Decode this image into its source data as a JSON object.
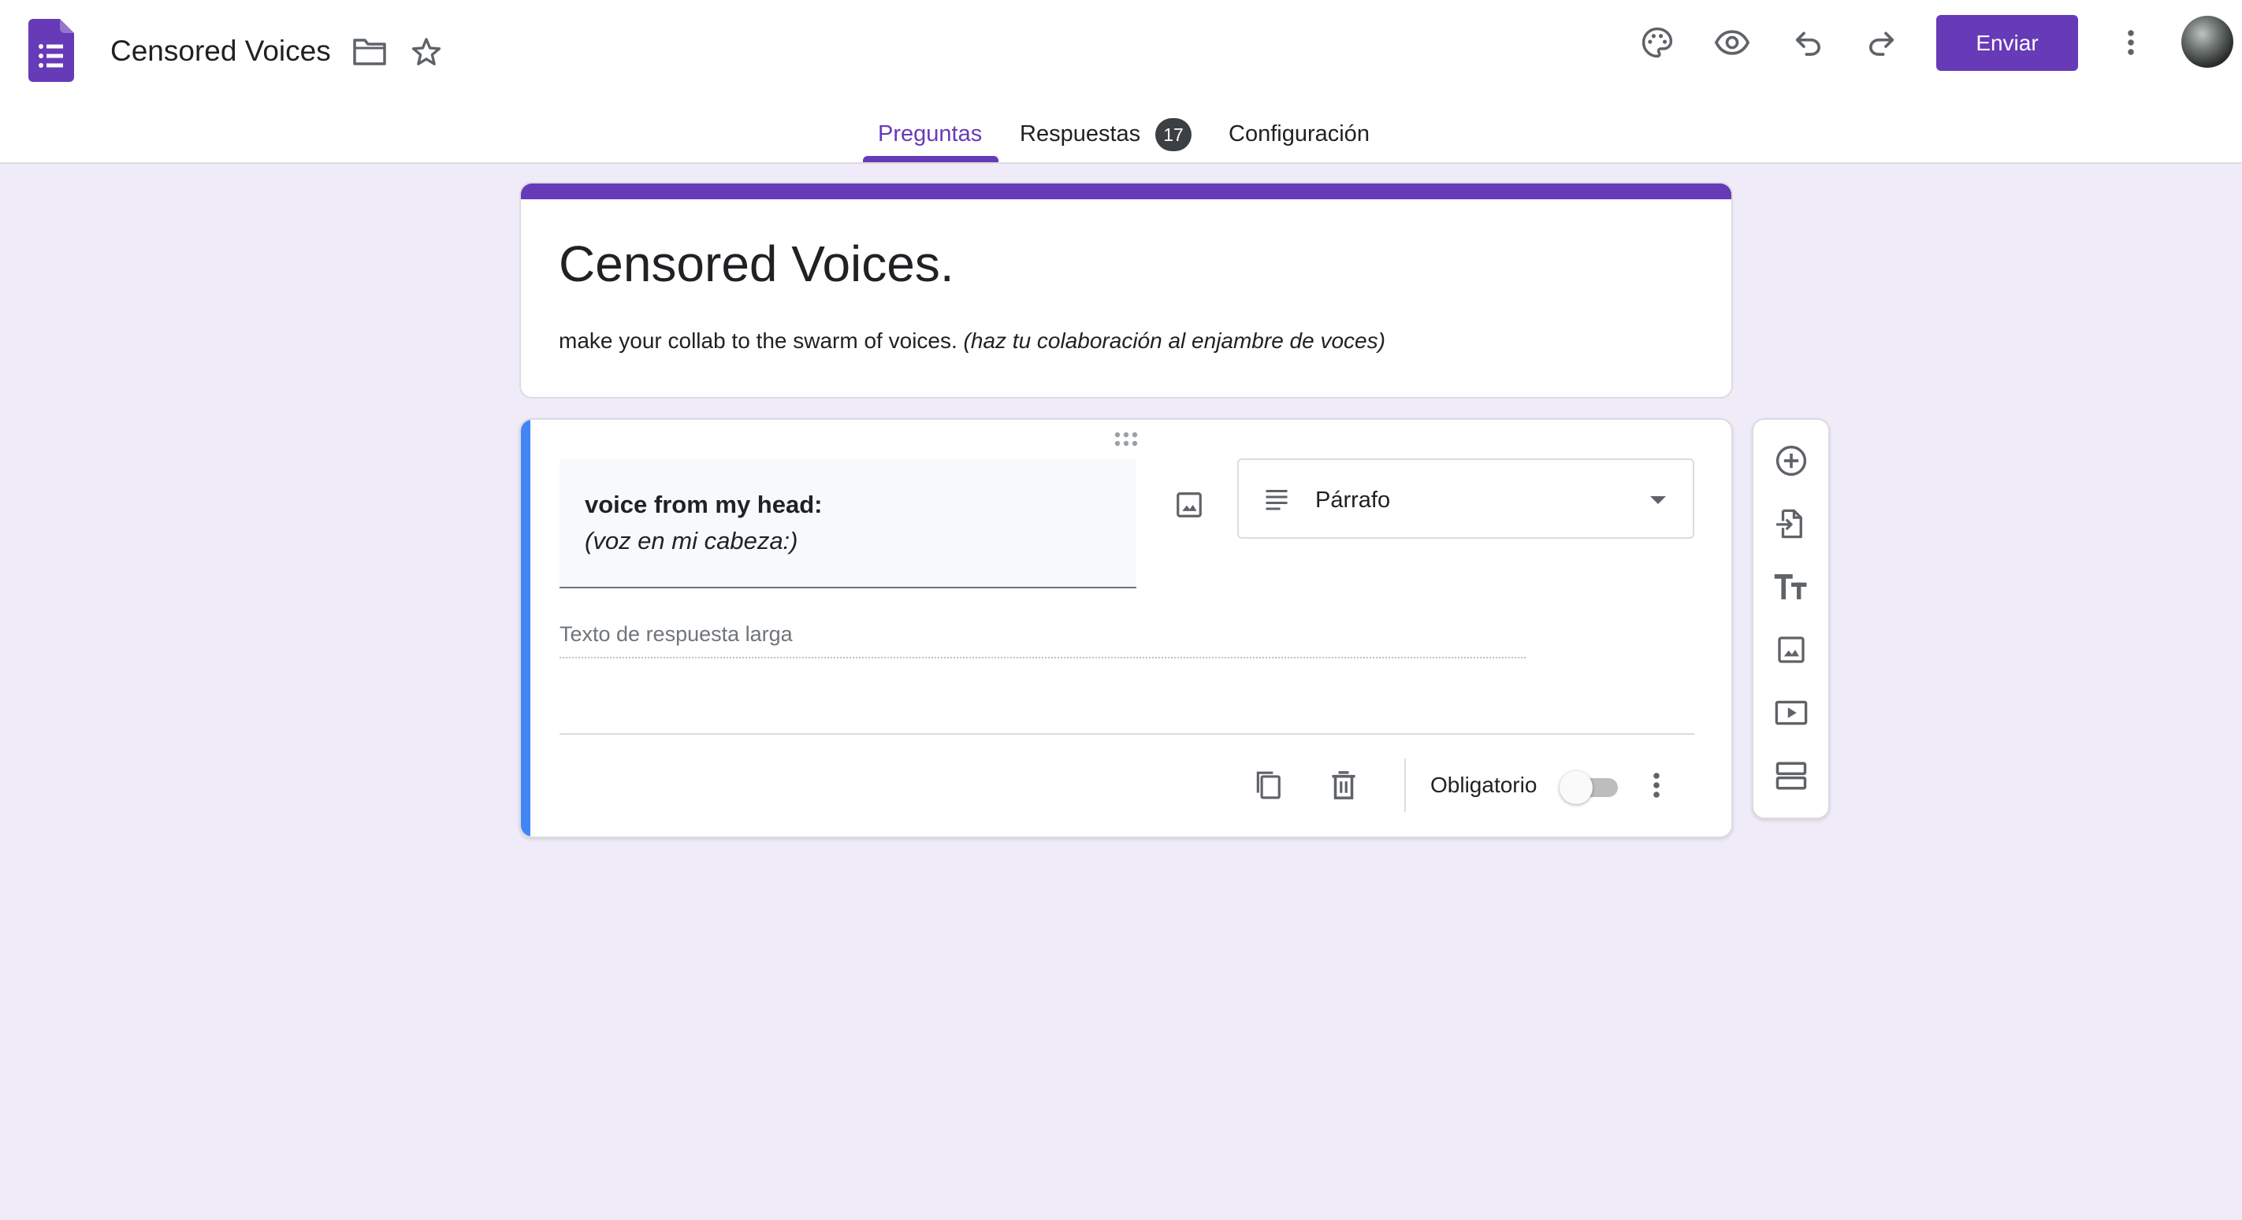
{
  "header": {
    "doc_title": "Censored Voices",
    "send_label": "Enviar",
    "icons": [
      "forms-logo-icon",
      "folder-icon",
      "star-icon",
      "palette-icon",
      "preview-eye-icon",
      "undo-icon",
      "redo-icon",
      "more-vert-icon"
    ]
  },
  "tabs": [
    {
      "label": "Preguntas",
      "active": true
    },
    {
      "label": "Respuestas",
      "badge": "17"
    },
    {
      "label": "Configuración"
    }
  ],
  "form": {
    "title": "Censored Voices.",
    "description_plain": "make your collab to the swarm of voices.",
    "description_italic": "(haz tu colaboración al enjambre de voces)"
  },
  "question": {
    "title_line1": "voice from my head:",
    "title_line2": "(voz en mi cabeza:)",
    "type_label": "Párrafo",
    "answer_placeholder": "Texto de respuesta larga",
    "required_label": "Obligatorio",
    "required": false
  },
  "side_toolbar": {
    "tools": [
      "add-question-icon",
      "import-questions-icon",
      "add-title-icon",
      "add-image-icon",
      "add-video-icon",
      "add-section-icon"
    ]
  },
  "colors": {
    "accent": "#673ab7",
    "background": "#f0ebf8",
    "active_card_bar": "#4285f4",
    "badge": "#3c4043"
  }
}
